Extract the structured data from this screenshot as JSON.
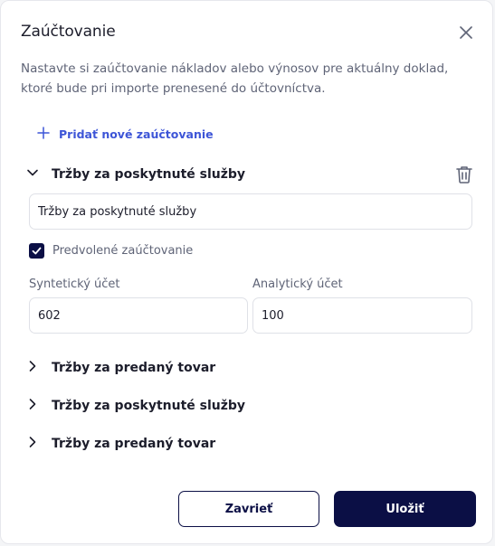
{
  "dialog": {
    "title": "Zaúčtovanie",
    "description": "Nastavte si zaúčtovanie nákladov alebo výnosov pre aktuálny doklad, ktoré bude pri importe prenesené do účtovníctva."
  },
  "add_link": {
    "label": "Pridať nové zaúčtovanie"
  },
  "expanded_item": {
    "title": "Tržby za poskytnuté služby",
    "name_value": "Tržby za poskytnuté služby",
    "default_checkbox": {
      "label": "Predvolené zaúčtovanie",
      "checked": true
    },
    "synthetic_account": {
      "label": "Syntetický účet",
      "value": "602"
    },
    "analytic_account": {
      "label": "Analytický účet",
      "value": "100"
    }
  },
  "collapsed_items": [
    {
      "title": "Tržby za predaný tovar"
    },
    {
      "title": "Tržby za poskytnuté služby"
    },
    {
      "title": "Tržby za predaný tovar"
    }
  ],
  "buttons": {
    "close": "Zavrieť",
    "save": "Uložiť"
  },
  "icons": {
    "close": "close-icon",
    "plus": "plus-icon",
    "chevron_down": "chevron-down-icon",
    "chevron_right": "chevron-right-icon",
    "trash": "trash-icon",
    "check": "check-icon"
  },
  "colors": {
    "primary": "#0b0f45",
    "link": "#3d55d7",
    "text": "#1c1d2b",
    "muted": "#5f6477",
    "border": "#dfe1e7"
  }
}
